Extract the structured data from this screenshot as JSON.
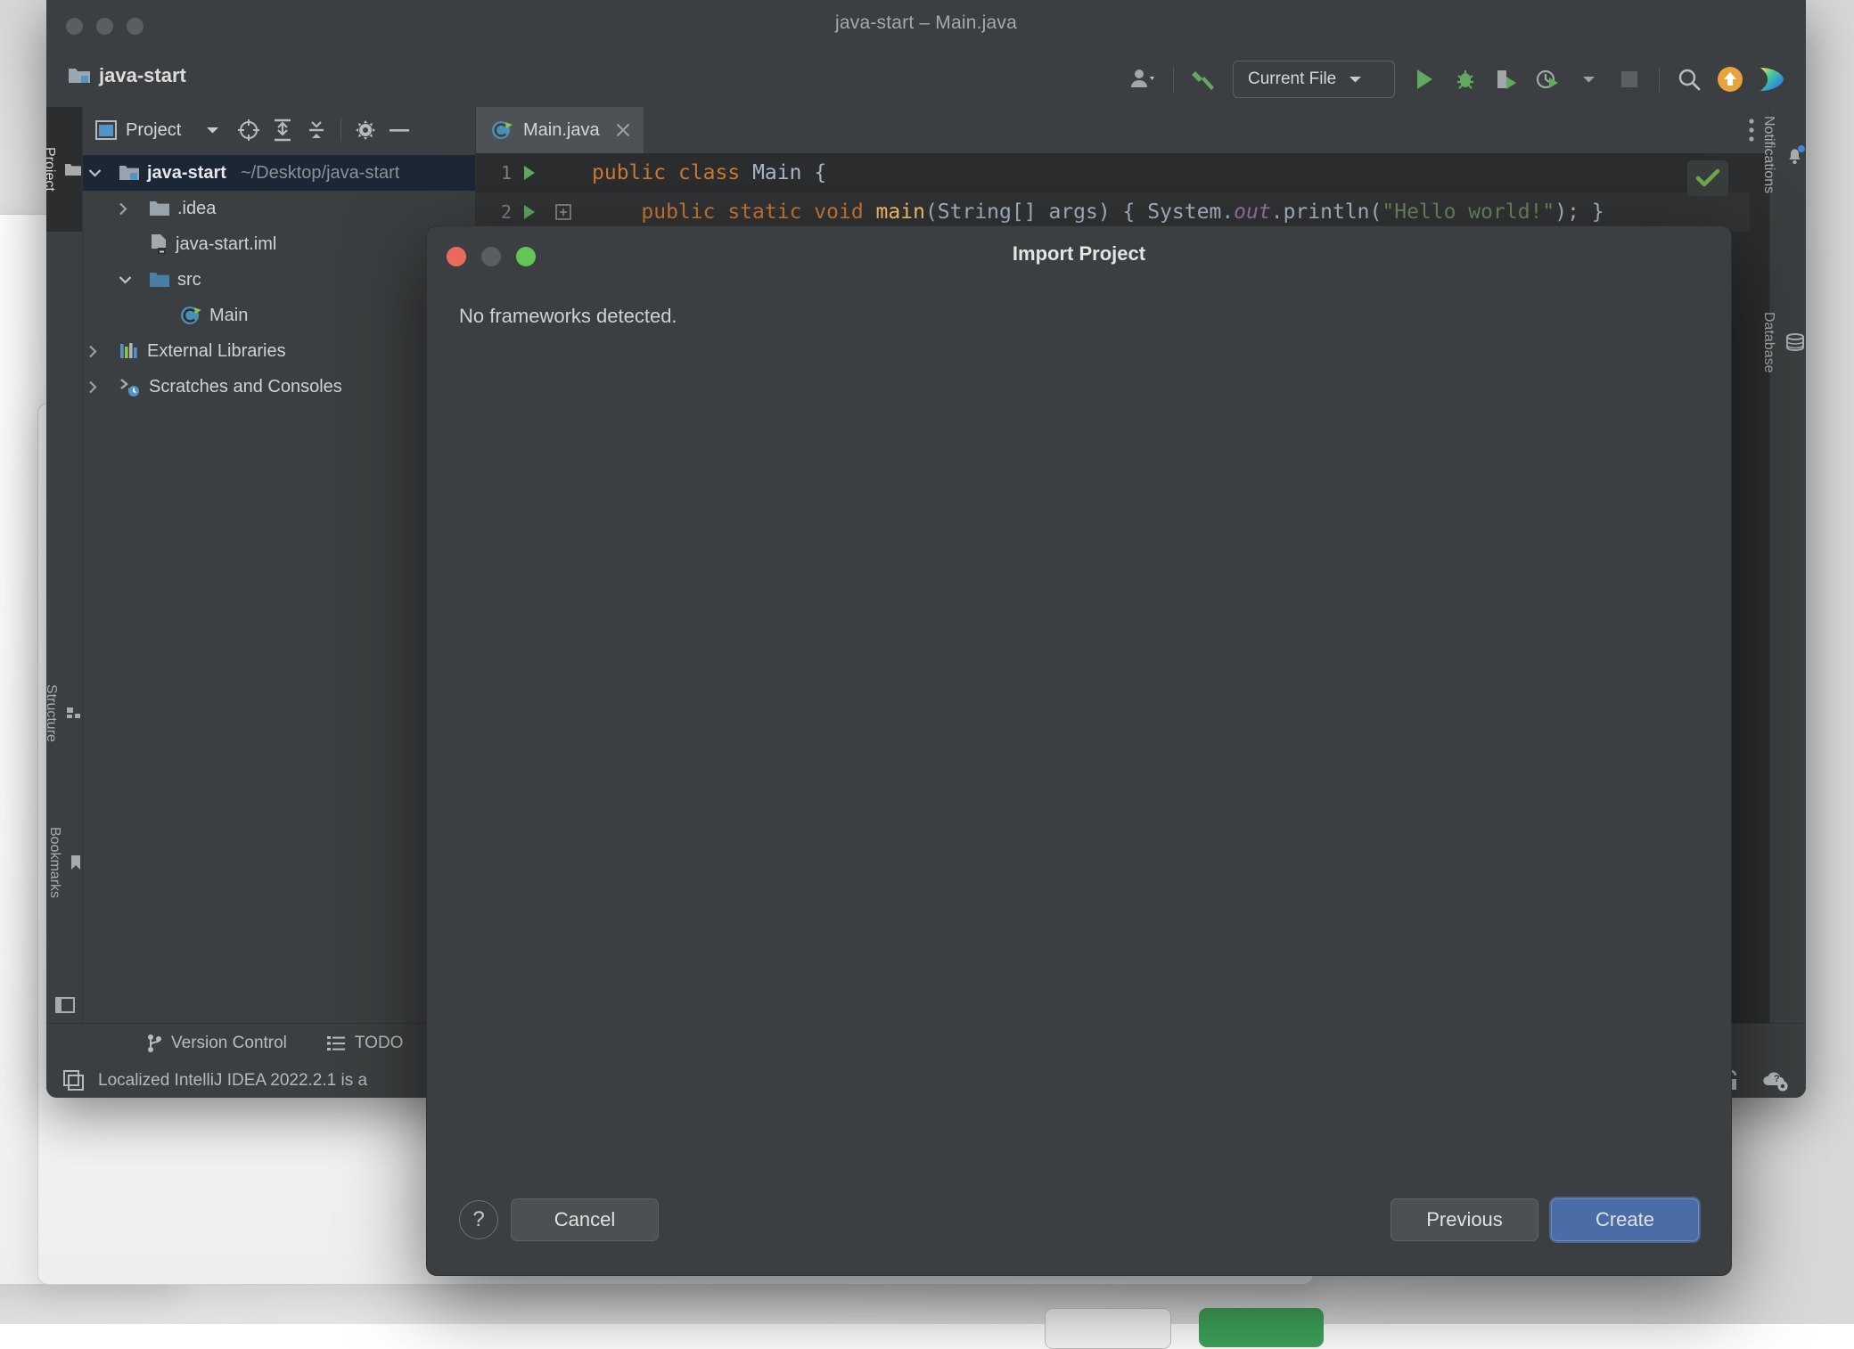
{
  "window": {
    "title": "java-start – Main.java",
    "project_name": "java-start",
    "traffic_lights": [
      "close-button",
      "minimize-button",
      "zoom-button"
    ]
  },
  "toolbar": {
    "account_icon": "user-account-icon",
    "build_icon": "hammer-build-icon",
    "run_config": {
      "label": "Current File",
      "chevron": "chevron-down-icon"
    },
    "run_icon": "run-icon",
    "debug_icon": "debug-bug-icon",
    "coverage_icon": "run-with-coverage-icon",
    "profiler_icon": "profiler-icon",
    "profiler_chevron": "chevron-down-icon",
    "stop_icon": "stop-icon",
    "search_icon": "search-everywhere-icon",
    "update_icon": "update-available-icon",
    "ide_feature_icon": "ide-assistant-icon"
  },
  "left_rail": {
    "items": [
      {
        "label": "Project",
        "icon": "project-folder-icon",
        "active": true
      },
      {
        "label": "Structure",
        "icon": "structure-icon",
        "active": false
      },
      {
        "label": "Bookmarks",
        "icon": "bookmarks-icon",
        "active": false
      }
    ],
    "bottom_icon": "layout-toggle-icon"
  },
  "right_rail": {
    "items": [
      {
        "label": "Notifications",
        "icon": "notifications-bell-icon",
        "badge": true
      },
      {
        "label": "Database",
        "icon": "database-icon",
        "badge": false
      }
    ]
  },
  "project_panel": {
    "title": "Project",
    "title_icon": "project-view-icon",
    "chevron": "chevron-down-icon",
    "actions": [
      {
        "name": "select-opened-file-icon"
      },
      {
        "name": "expand-all-icon"
      },
      {
        "name": "collapse-all-icon"
      },
      {
        "name": "settings-gear-icon"
      },
      {
        "name": "hide-panel-icon"
      }
    ],
    "tree": [
      {
        "indent": 0,
        "twisty": "v",
        "icon": "project-root-icon",
        "label": "java-start",
        "path": "~/Desktop/java-start",
        "bold": true,
        "selected": true
      },
      {
        "indent": 1,
        "twisty": ">",
        "icon": "folder-icon",
        "label": ".idea",
        "path": "",
        "bold": false,
        "selected": false
      },
      {
        "indent": 2,
        "twisty": "",
        "icon": "iml-file-icon",
        "label": "java-start.iml",
        "path": "",
        "bold": false,
        "selected": false
      },
      {
        "indent": 1,
        "twisty": "v",
        "icon": "source-folder-icon",
        "label": "src",
        "path": "",
        "bold": false,
        "selected": false
      },
      {
        "indent": 2,
        "twisty": "",
        "icon": "java-class-icon",
        "label": "Main",
        "path": "",
        "bold": false,
        "selected": false
      },
      {
        "indent": 0,
        "twisty": ">",
        "icon": "external-libraries-icon",
        "label": "External Libraries",
        "path": "",
        "bold": false,
        "selected": false
      },
      {
        "indent": 0,
        "twisty": ">",
        "icon": "scratches-icon",
        "label": "Scratches and Consoles",
        "path": "",
        "bold": false,
        "selected": false
      }
    ]
  },
  "editor": {
    "tab": {
      "label": "Main.java",
      "icon": "java-class-icon",
      "close_icon": "close-icon"
    },
    "more_icon": "more-options-icon",
    "inspection_status_icon": "inspections-ok-checkmark-icon",
    "lines": [
      {
        "number": "1",
        "run_marker": "run-gutter-icon",
        "fold_marker": "",
        "current": false,
        "tokens": [
          {
            "t": "public",
            "c": "kw"
          },
          {
            "t": " ",
            "c": "pun"
          },
          {
            "t": "class",
            "c": "kw"
          },
          {
            "t": " ",
            "c": "pun"
          },
          {
            "t": "Main",
            "c": "typ"
          },
          {
            "t": " {",
            "c": "pun"
          }
        ]
      },
      {
        "number": "2",
        "run_marker": "run-gutter-icon",
        "fold_marker": "expand-fold-icon",
        "current": true,
        "tokens": [
          {
            "t": "    ",
            "c": "pun"
          },
          {
            "t": "public",
            "c": "kw"
          },
          {
            "t": " ",
            "c": "pun"
          },
          {
            "t": "static",
            "c": "kw"
          },
          {
            "t": " ",
            "c": "pun"
          },
          {
            "t": "void",
            "c": "kw"
          },
          {
            "t": " ",
            "c": "pun"
          },
          {
            "t": "main",
            "c": "fn"
          },
          {
            "t": "(",
            "c": "pun"
          },
          {
            "t": "String",
            "c": "typ"
          },
          {
            "t": "[] ",
            "c": "pun"
          },
          {
            "t": "args",
            "c": "typ"
          },
          {
            "t": ") { ",
            "c": "pun"
          },
          {
            "t": "System",
            "c": "typ"
          },
          {
            "t": ".",
            "c": "pun"
          },
          {
            "t": "out",
            "c": "fld"
          },
          {
            "t": ".",
            "c": "pun"
          },
          {
            "t": "println",
            "c": "mth"
          },
          {
            "t": "(",
            "c": "pun"
          },
          {
            "t": "\"Hello world!\"",
            "c": "str"
          },
          {
            "t": "); }",
            "c": "pun"
          }
        ]
      }
    ]
  },
  "bottom_tools": [
    {
      "label": "Version Control",
      "icon": "version-control-branch-icon"
    },
    {
      "label": "TODO",
      "icon": "todo-list-icon"
    }
  ],
  "status_bar": {
    "message": "Localized IntelliJ IDEA 2022.2.1 is a",
    "left_icon": "event-log-icon",
    "right_icons": [
      {
        "name": "unlock-readonly-icon"
      },
      {
        "name": "cloud-settings-icon"
      }
    ]
  },
  "dialog": {
    "title": "Import Project",
    "message": "No frameworks detected.",
    "traffic_lights": [
      "close-button",
      "minimize-button",
      "zoom-button"
    ],
    "help_label": "?",
    "buttons": {
      "cancel": "Cancel",
      "previous": "Previous",
      "create": "Create"
    },
    "colors": {
      "primary": "#4a6da7",
      "close": "#eb6a5e",
      "zoom": "#62c554"
    }
  },
  "colors": {
    "ide_background": "#3c3f41",
    "editor_background": "#2b2d2e",
    "selection": "#1b2735",
    "accent_green": "#62a862",
    "accent_orange": "#e8a33d",
    "keyword": "#cc7832",
    "string": "#6a8759",
    "field": "#9876aa",
    "method": "#ffc66d"
  }
}
